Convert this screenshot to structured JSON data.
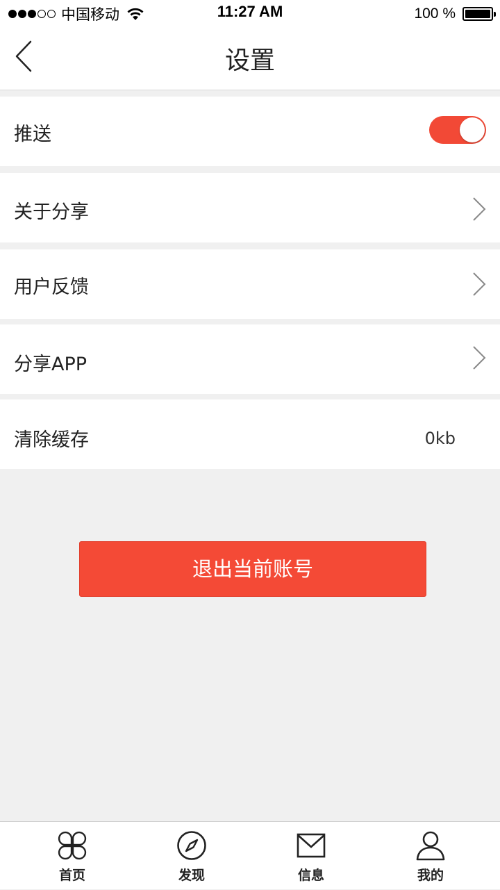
{
  "status_bar": {
    "carrier": "中国移动",
    "time": "11:27 AM",
    "battery": "100 %"
  },
  "nav": {
    "title": "设置"
  },
  "settings": {
    "push_label": "推送",
    "push_enabled": true,
    "about_label": "关于分享",
    "feedback_label": "用户反馈",
    "share_app_label": "分享APP",
    "clear_cache_label": "清除缓存",
    "cache_size": "0kb"
  },
  "logout_label": "退出当前账号",
  "tabs": [
    {
      "label": "首页",
      "icon": "clover-icon"
    },
    {
      "label": "发现",
      "icon": "compass-icon"
    },
    {
      "label": "信息",
      "icon": "envelope-icon"
    },
    {
      "label": "我的",
      "icon": "person-icon"
    }
  ],
  "colors": {
    "accent": "#f24936",
    "background": "#f0f0f0"
  }
}
